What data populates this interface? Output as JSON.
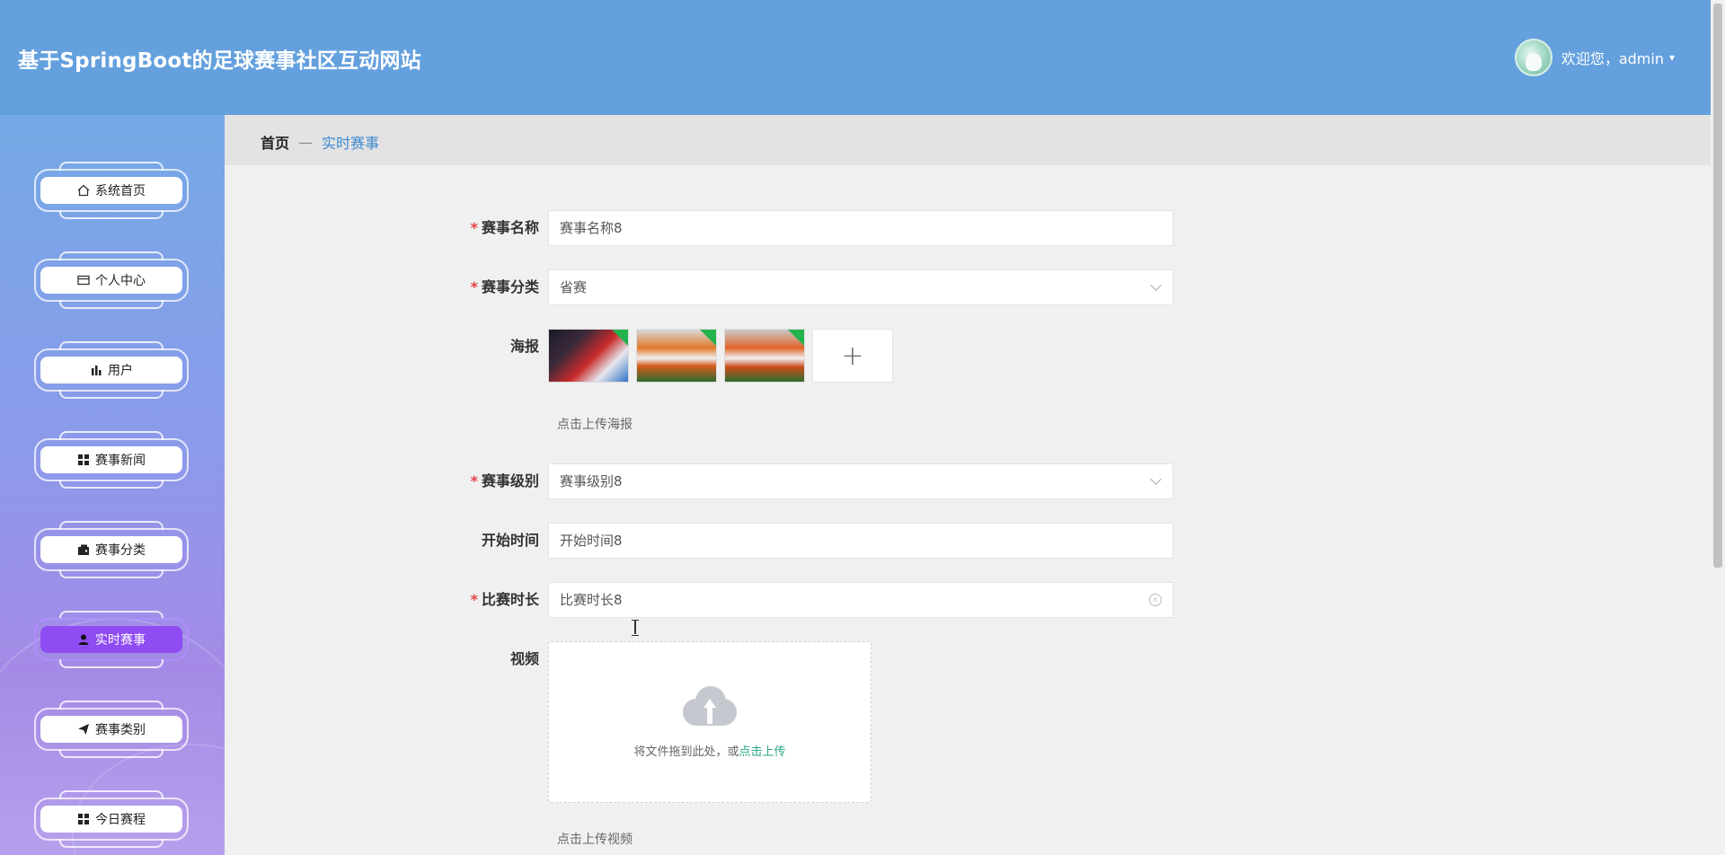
{
  "header": {
    "title": "基于SpringBoot的足球赛事社区互动网站",
    "welcome": "欢迎您，admin",
    "caret": "▾"
  },
  "sidebar": {
    "items": [
      {
        "label": "系统首页",
        "icon": "home-icon",
        "active": false
      },
      {
        "label": "个人中心",
        "icon": "card-icon",
        "active": false
      },
      {
        "label": "用户",
        "icon": "bar-chart-icon",
        "active": false
      },
      {
        "label": "赛事新闻",
        "icon": "grid-icon",
        "active": false
      },
      {
        "label": "赛事分类",
        "icon": "wallet-icon",
        "active": false
      },
      {
        "label": "实时赛事",
        "icon": "user-icon",
        "active": true
      },
      {
        "label": "赛事类别",
        "icon": "paper-plane-icon",
        "active": false
      },
      {
        "label": "今日赛程",
        "icon": "grid-icon",
        "active": false
      }
    ]
  },
  "breadcrumb": {
    "home": "首页",
    "separator": "—",
    "current": "实时赛事"
  },
  "form": {
    "name": {
      "label": "赛事名称",
      "placeholder": "赛事名称8",
      "required": true
    },
    "category": {
      "label": "赛事分类",
      "value": "省赛",
      "required": true
    },
    "poster": {
      "label": "海报",
      "hint": "点击上传海报",
      "plus": "+"
    },
    "level": {
      "label": "赛事级别",
      "value": "赛事级别8",
      "required": true
    },
    "start_time": {
      "label": "开始时间",
      "placeholder": "开始时间8",
      "required": false
    },
    "duration": {
      "label": "比赛时长",
      "placeholder": "比赛时长8",
      "required": true
    },
    "video": {
      "label": "视频",
      "drop_text": "将文件拖到此处，或",
      "upload_link": "点击上传",
      "hint": "点击上传视频"
    }
  },
  "colors": {
    "header": "#64a0de",
    "active_menu": "#8f4cf2",
    "breadcrumb_current": "#3d8ad1",
    "required": "#e54545",
    "upload_link": "#2aa58a"
  }
}
